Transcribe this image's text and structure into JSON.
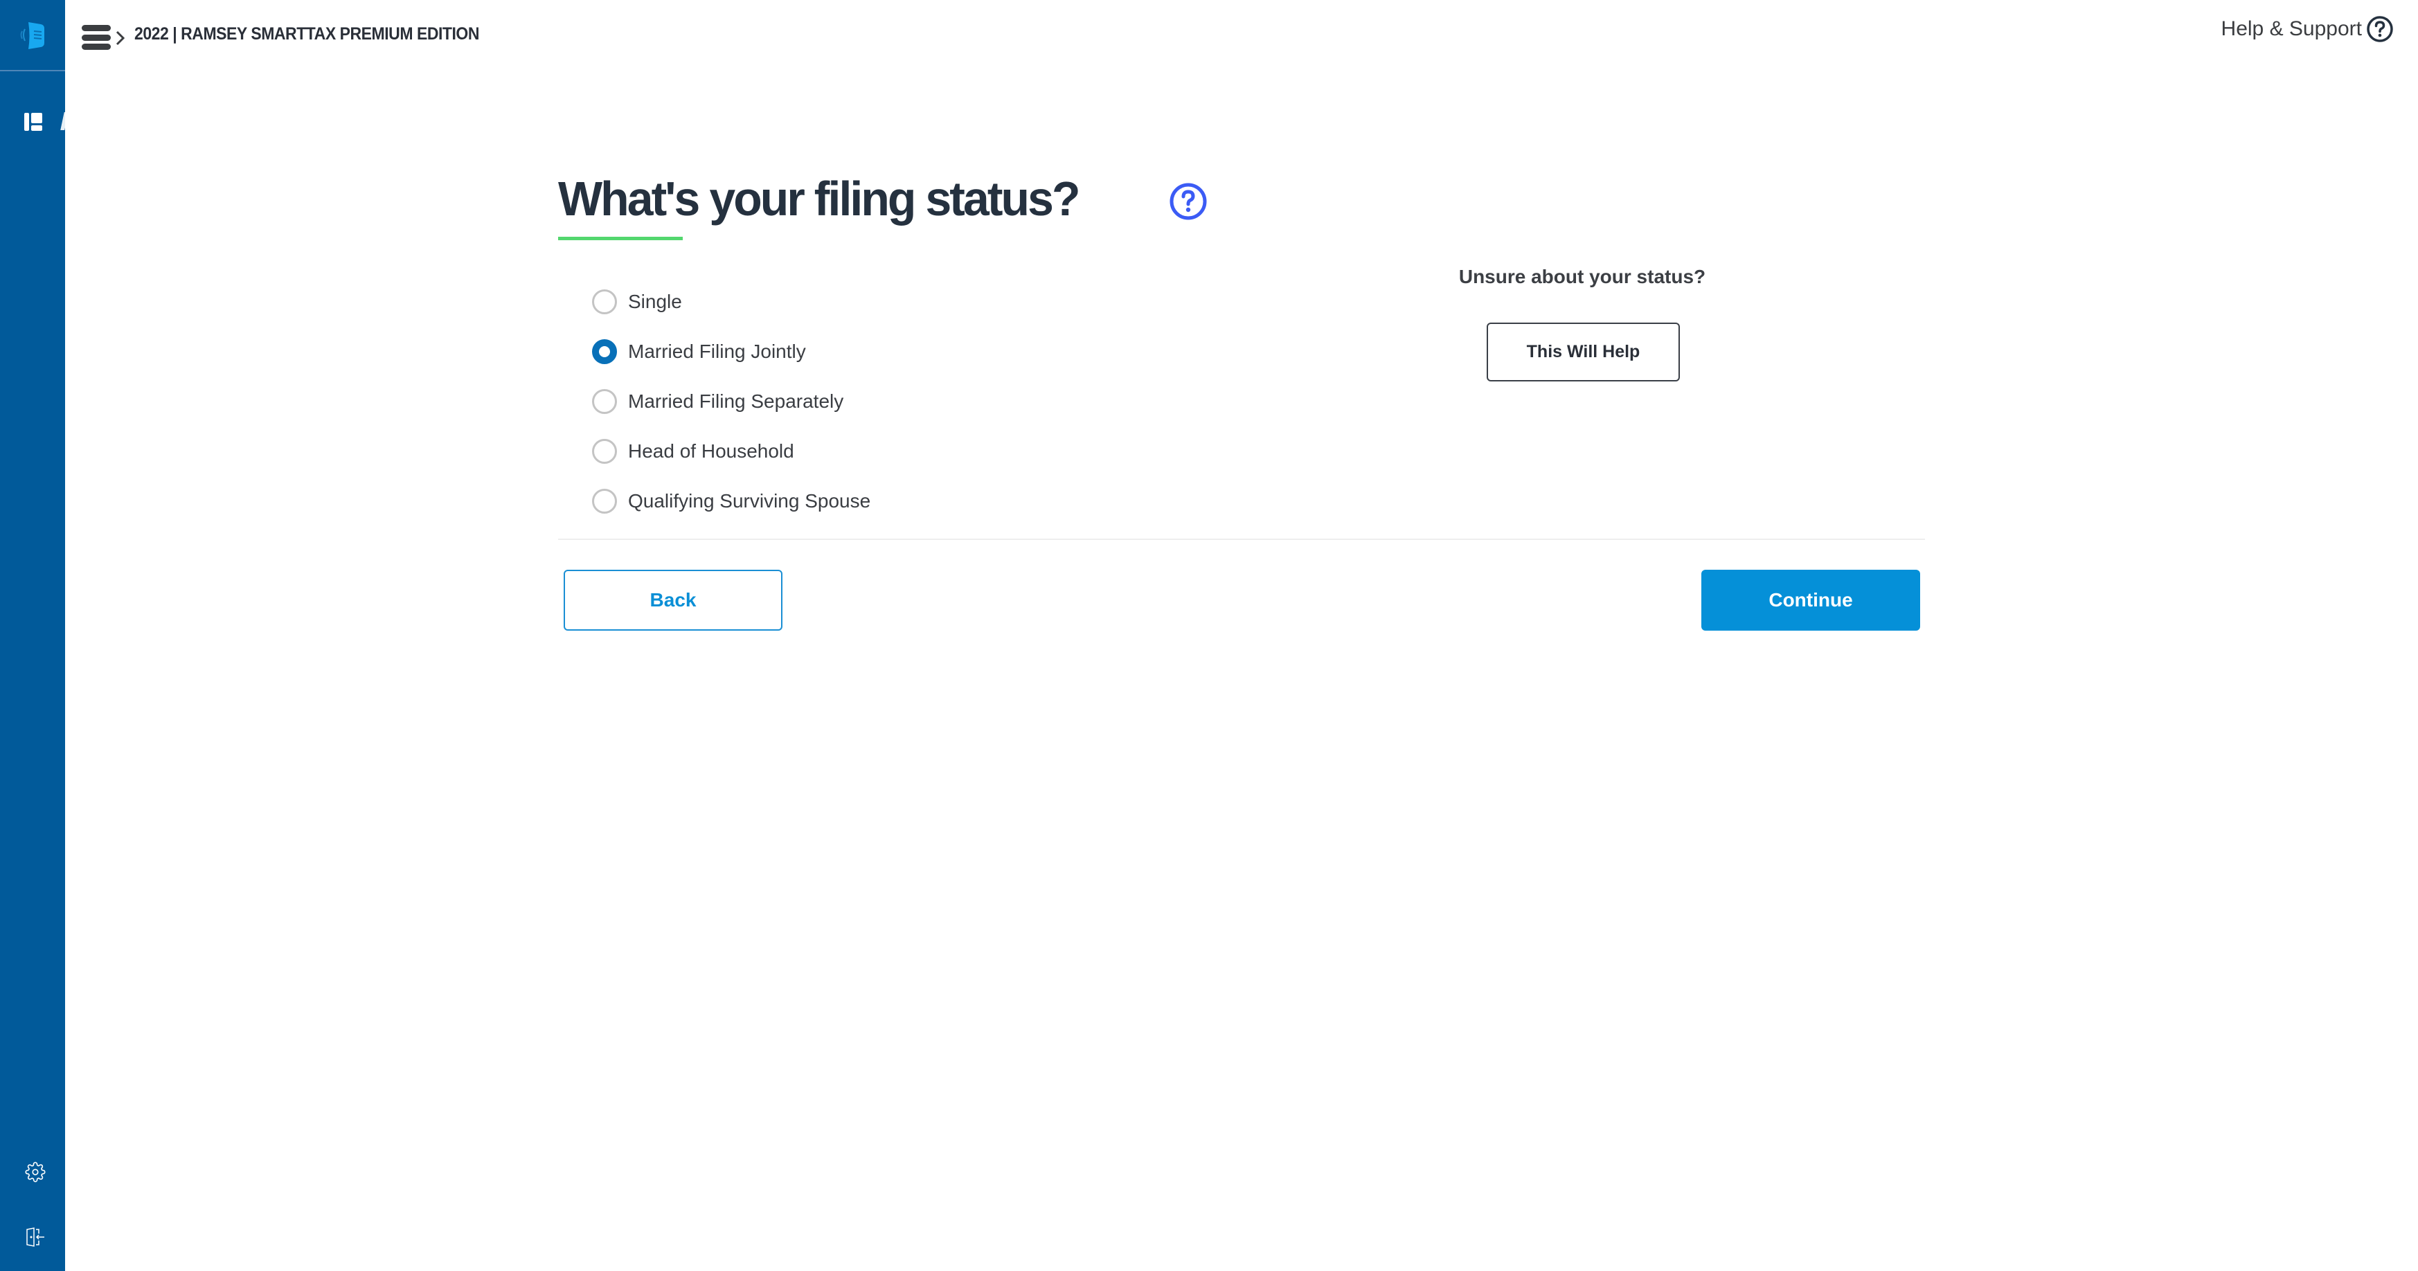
{
  "header": {
    "title": "2022 | RAMSEY SMARTTAX PREMIUM EDITION",
    "help_support_label": "Help & Support"
  },
  "sidebar": {
    "items": [
      {
        "icon": "dashboard-icon"
      },
      {
        "icon": "gear-icon"
      },
      {
        "icon": "logout-icon"
      }
    ]
  },
  "main": {
    "title": "What's your filing status?",
    "options": [
      {
        "label": "Single",
        "checked": false
      },
      {
        "label": "Married Filing Jointly",
        "checked": true
      },
      {
        "label": "Married Filing Separately",
        "checked": false
      },
      {
        "label": "Head of Household",
        "checked": false
      },
      {
        "label": "Qualifying Surviving Spouse",
        "checked": false
      }
    ],
    "selected": "Married Filing Jointly",
    "unsure_text": "Unsure about your status?",
    "help_button_label": "This Will Help",
    "back_label": "Back",
    "continue_label": "Continue"
  },
  "colors": {
    "sidebar": "#015a9a",
    "accent_green": "#53d76e",
    "primary_blue": "#0590d8",
    "radio_selected": "#0870b8",
    "title_help_icon": "#3b5bf5"
  }
}
